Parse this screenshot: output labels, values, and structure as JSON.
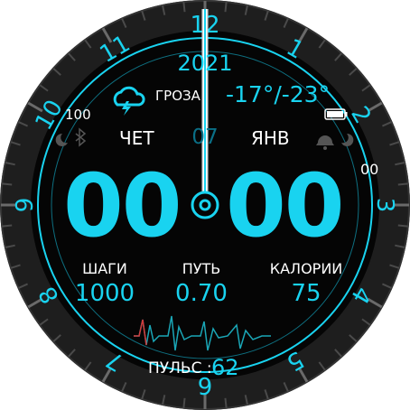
{
  "date": {
    "year": "2021",
    "weekday": "ЧЕТ",
    "day": "07",
    "month": "ЯНВ"
  },
  "weather": {
    "condition": "ГРОЗА",
    "temperature": "-17°/-23°",
    "icon": "thunderstorm-icon"
  },
  "battery": {
    "percent_label": "100",
    "level_percent": 100
  },
  "time": {
    "hours": "00",
    "minutes": "00",
    "seconds": "00"
  },
  "stats": {
    "steps_label": "ШАГИ",
    "steps_value": "1000",
    "distance_label": "ПУТЬ",
    "distance_value": "0.70",
    "calories_label": "КАЛОРИИ",
    "calories_value": "75"
  },
  "pulse": {
    "label": "ПУЛЬС :",
    "value": "62"
  },
  "dial": {
    "numerals": [
      "12",
      "1",
      "2",
      "3",
      "4",
      "5",
      "6",
      "7",
      "8",
      "9",
      "10",
      "11"
    ]
  },
  "status_icons": [
    "moon-icon",
    "bluetooth-icon",
    "alarm-icon",
    "moon-icon"
  ],
  "colors": {
    "accent": "#19d3f0",
    "background": "#000000",
    "bezel": "#1f1f1f",
    "text": "#ffffff"
  }
}
